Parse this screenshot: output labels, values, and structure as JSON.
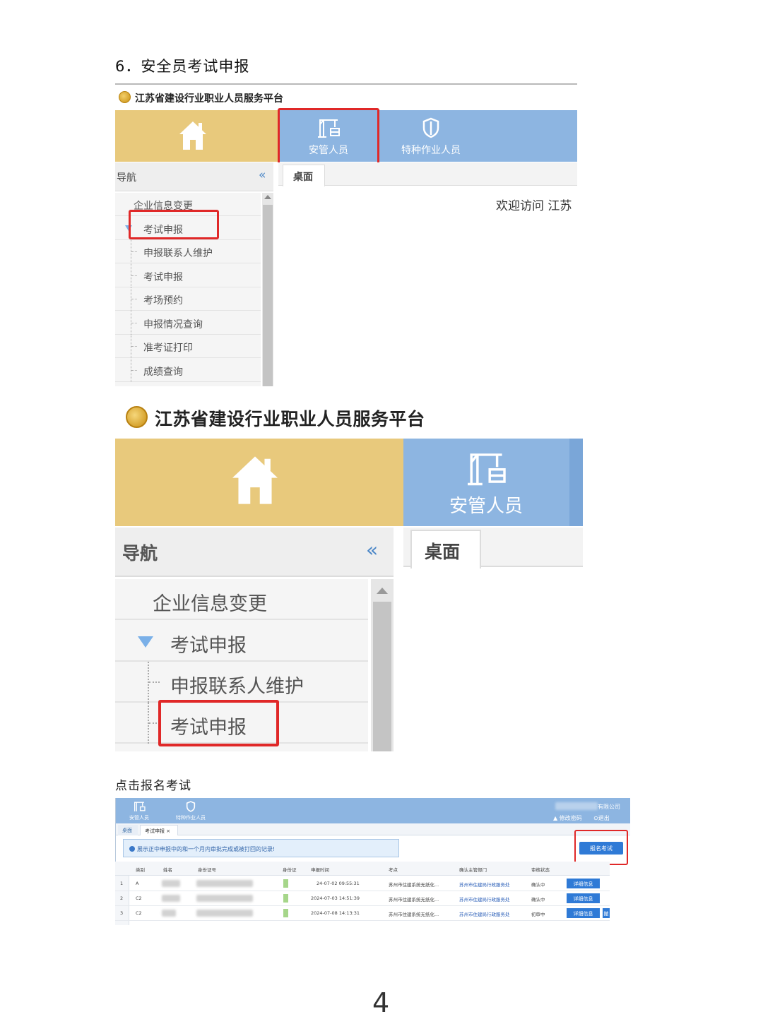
{
  "section_heading": "6．安全员考试申报",
  "shot1": {
    "platform_title": "江苏省建设行业职业人员服务平台",
    "tabs": [
      "安管人员",
      "特种作业人员"
    ],
    "nav_label": "导航",
    "collapse_symbol": "«",
    "desk_tab": "桌面",
    "welcome": "欢迎访问 江苏",
    "menu": [
      "企业信息变更",
      "考试申报",
      "申报联系人维护",
      "考试申报",
      "考场预约",
      "申报情况查询",
      "准考证打印",
      "成绩查询"
    ]
  },
  "shot2": {
    "platform_title": "江苏省建设行业职业人员服务平台",
    "tab": "安管人员",
    "nav_label": "导航",
    "collapse_symbol": "«",
    "desk_tab": "桌面",
    "menu": [
      "企业信息变更",
      "考试申报",
      "申报联系人维护",
      "考试申报"
    ]
  },
  "caption": "点击报名考试",
  "shot3": {
    "tabs": [
      "安管人员",
      "特种作业人员"
    ],
    "company_suffix": "有限公司",
    "change_password": "▲ 修改密码",
    "exit": "⊙退出",
    "page_tabs": [
      "桌面",
      "考试申报 ×"
    ],
    "notice": "展示正中申报中的和一个月内审批完成或被打回的记录!",
    "apply_button": "报名考试",
    "columns": [
      "类别",
      "姓名",
      "身份证号",
      "身份证",
      "申报时间",
      "考点",
      "确认主管部门",
      "审核状态"
    ],
    "rows": [
      {
        "no": "1",
        "category": "A",
        "time": "24-07-02 09:55:31",
        "site": "苏州市住建系统无纸化...",
        "dept": "苏州市住建局行政服务处",
        "status": "确认中",
        "actions": [
          "详细信息"
        ]
      },
      {
        "no": "2",
        "category": "C2",
        "time": "2024-07-03 14:51:39",
        "site": "苏州市住建系统无纸化...",
        "dept": "苏州市住建局行政服务处",
        "status": "确认中",
        "actions": [
          "详细信息"
        ]
      },
      {
        "no": "3",
        "category": "C2",
        "time": "2024-07-08 14:13:31",
        "site": "苏州市住建系统无纸化...",
        "dept": "苏州市住建局行政服务处",
        "status": "初审中",
        "actions": [
          "详细信息",
          "撤"
        ]
      }
    ]
  },
  "page_number": "4",
  "colors": {
    "gold": "#e8c97c",
    "blue": "#8db5e1",
    "highlight": "#e02828"
  }
}
